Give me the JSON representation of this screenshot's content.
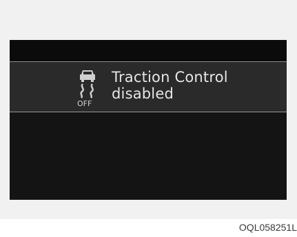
{
  "display": {
    "message_line1": "Traction Control",
    "message_line2": "disabled",
    "icon_name": "traction-control-off-icon",
    "icon_label": "OFF"
  },
  "caption": "OQL058251L",
  "colors": {
    "background": "#f1f1f1",
    "screen": "#111111",
    "message_band": "#2a2a2a",
    "text": "#e6e6e6"
  }
}
